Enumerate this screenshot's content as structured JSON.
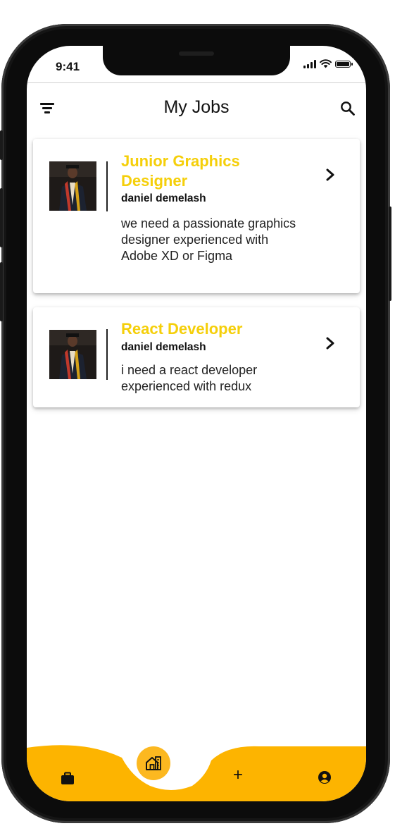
{
  "status_bar": {
    "time": "9:41"
  },
  "header": {
    "title": "My Jobs",
    "filter_icon": "filter-icon",
    "search_icon": "search-icon"
  },
  "jobs": [
    {
      "title": "Junior Graphics Designer",
      "author": "daniel demelash",
      "description": "we need a passionate graphics designer experienced with Adobe XD or Figma"
    },
    {
      "title": "React Developer",
      "author": "daniel demelash",
      "description": "i need a react developer experienced with redux"
    }
  ],
  "bottom_nav": {
    "items": [
      {
        "icon": "briefcase-icon"
      },
      {
        "icon": "home-building-icon",
        "active": true
      },
      {
        "icon": "plus-icon",
        "label": "+"
      },
      {
        "icon": "user-circle-icon"
      }
    ]
  },
  "colors": {
    "accent": "#f5cf0a",
    "nav_bar": "#fdb400",
    "active_bubble": "#fcb820",
    "text": "#111111"
  }
}
